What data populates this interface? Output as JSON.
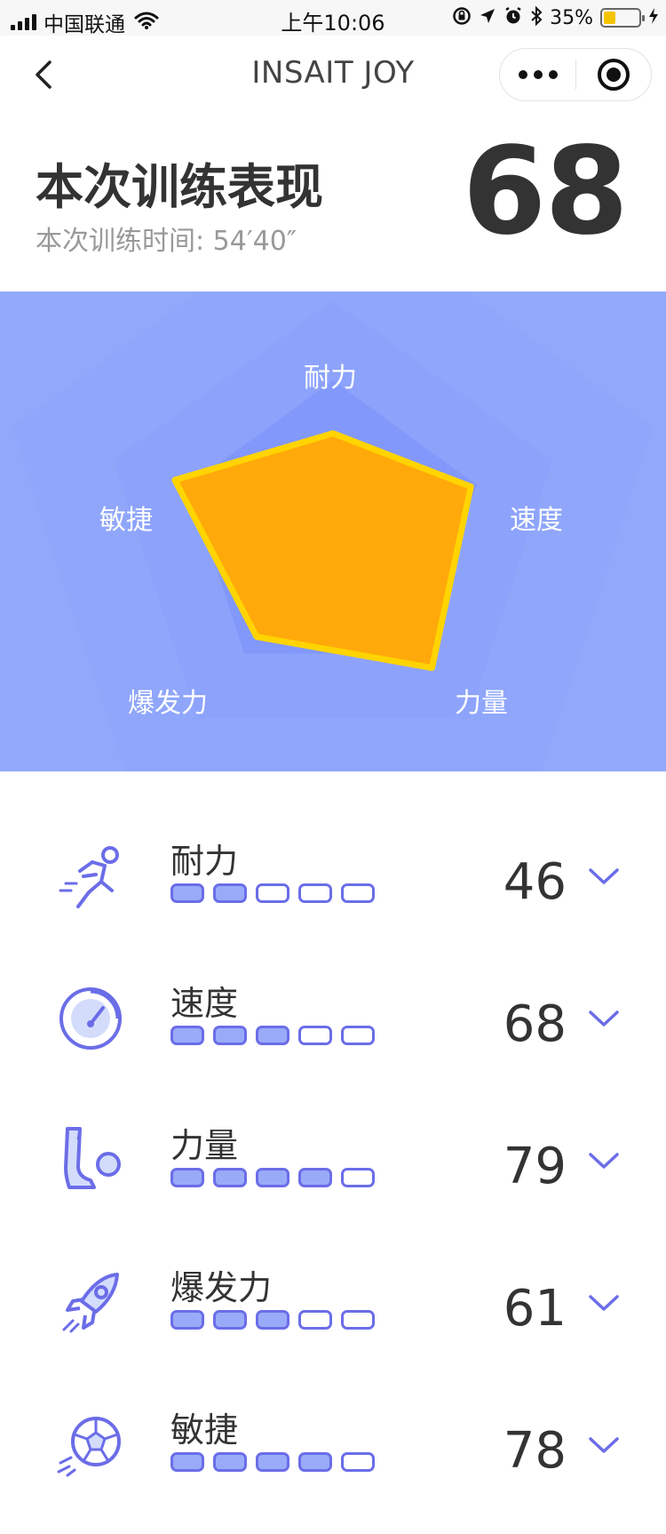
{
  "status_bar": {
    "carrier": "中国联通",
    "time": "上午10:06",
    "battery": "35%",
    "battery_level": 0.35
  },
  "nav": {
    "title": "INSAIT JOY"
  },
  "summary": {
    "title": "本次训练表现",
    "time_label": "本次训练时间: 54′40″",
    "score": "68"
  },
  "radar": {
    "axes": [
      "耐力",
      "速度",
      "力量",
      "爆发力",
      "敏捷"
    ],
    "values": [
      46,
      68,
      79,
      61,
      78
    ],
    "max": 100,
    "fill_color": "#ffa90a",
    "stroke_color": "#ffd400"
  },
  "stats": [
    {
      "label": "耐力",
      "value": "46",
      "segments_filled": 2,
      "segments_total": 5,
      "icon": "runner-icon"
    },
    {
      "label": "速度",
      "value": "68",
      "segments_filled": 3,
      "segments_total": 5,
      "icon": "speedometer-icon"
    },
    {
      "label": "力量",
      "value": "79",
      "segments_filled": 4,
      "segments_total": 5,
      "icon": "leg-kick-icon"
    },
    {
      "label": "爆发力",
      "value": "61",
      "segments_filled": 3,
      "segments_total": 5,
      "icon": "rocket-icon"
    },
    {
      "label": "敏捷",
      "value": "78",
      "segments_filled": 4,
      "segments_total": 5,
      "icon": "soccer-ball-icon"
    }
  ],
  "colors": {
    "accent": "#6b6de8",
    "segment_fill": "#99abf8",
    "radar_bg": "#92a9fb"
  }
}
